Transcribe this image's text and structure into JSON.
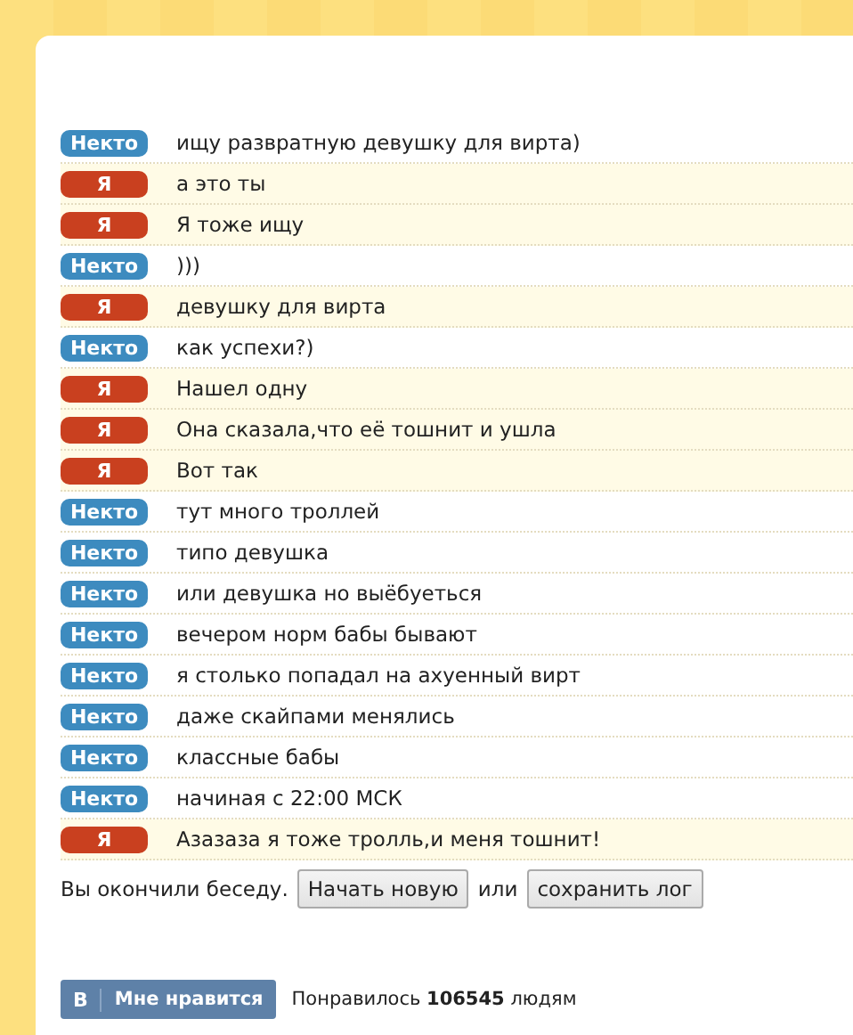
{
  "messages": [
    {
      "author": "Некто",
      "kind": "stranger",
      "text": "ищу развратную девушку для вирта)"
    },
    {
      "author": "Я",
      "kind": "me",
      "text": "а это ты"
    },
    {
      "author": "Я",
      "kind": "me",
      "text": "Я тоже ищу"
    },
    {
      "author": "Некто",
      "kind": "stranger",
      "text": ")))"
    },
    {
      "author": "Я",
      "kind": "me",
      "text": "девушку для вирта"
    },
    {
      "author": "Некто",
      "kind": "stranger",
      "text": "как успехи?)"
    },
    {
      "author": "Я",
      "kind": "me",
      "text": "Нашел одну"
    },
    {
      "author": "Я",
      "kind": "me",
      "text": "Она сказала,что её тошнит и ушла"
    },
    {
      "author": "Я",
      "kind": "me",
      "text": "Вот так"
    },
    {
      "author": "Некто",
      "kind": "stranger",
      "text": "тут много троллей"
    },
    {
      "author": "Некто",
      "kind": "stranger",
      "text": "типо девушка"
    },
    {
      "author": "Некто",
      "kind": "stranger",
      "text": "или девушка но выёбуеться"
    },
    {
      "author": "Некто",
      "kind": "stranger",
      "text": "вечером норм бабы бывают"
    },
    {
      "author": "Некто",
      "kind": "stranger",
      "text": "я столько попадал на ахуенный вирт"
    },
    {
      "author": "Некто",
      "kind": "stranger",
      "text": "даже скайпами менялись"
    },
    {
      "author": "Некто",
      "kind": "stranger",
      "text": "классные бабы"
    },
    {
      "author": "Некто",
      "kind": "stranger",
      "text": "начиная с 22:00 МСК"
    },
    {
      "author": "Я",
      "kind": "me",
      "text": "Азазаза я тоже тролль,и меня тошнит!"
    }
  ],
  "ended": {
    "text": "Вы окончили беседу.",
    "new_button": "Начать новую",
    "or": "или",
    "save_button": "сохранить лог"
  },
  "like": {
    "logo": "В",
    "button": "Мне нравится",
    "text": "Понравилось **106545** людям"
  }
}
